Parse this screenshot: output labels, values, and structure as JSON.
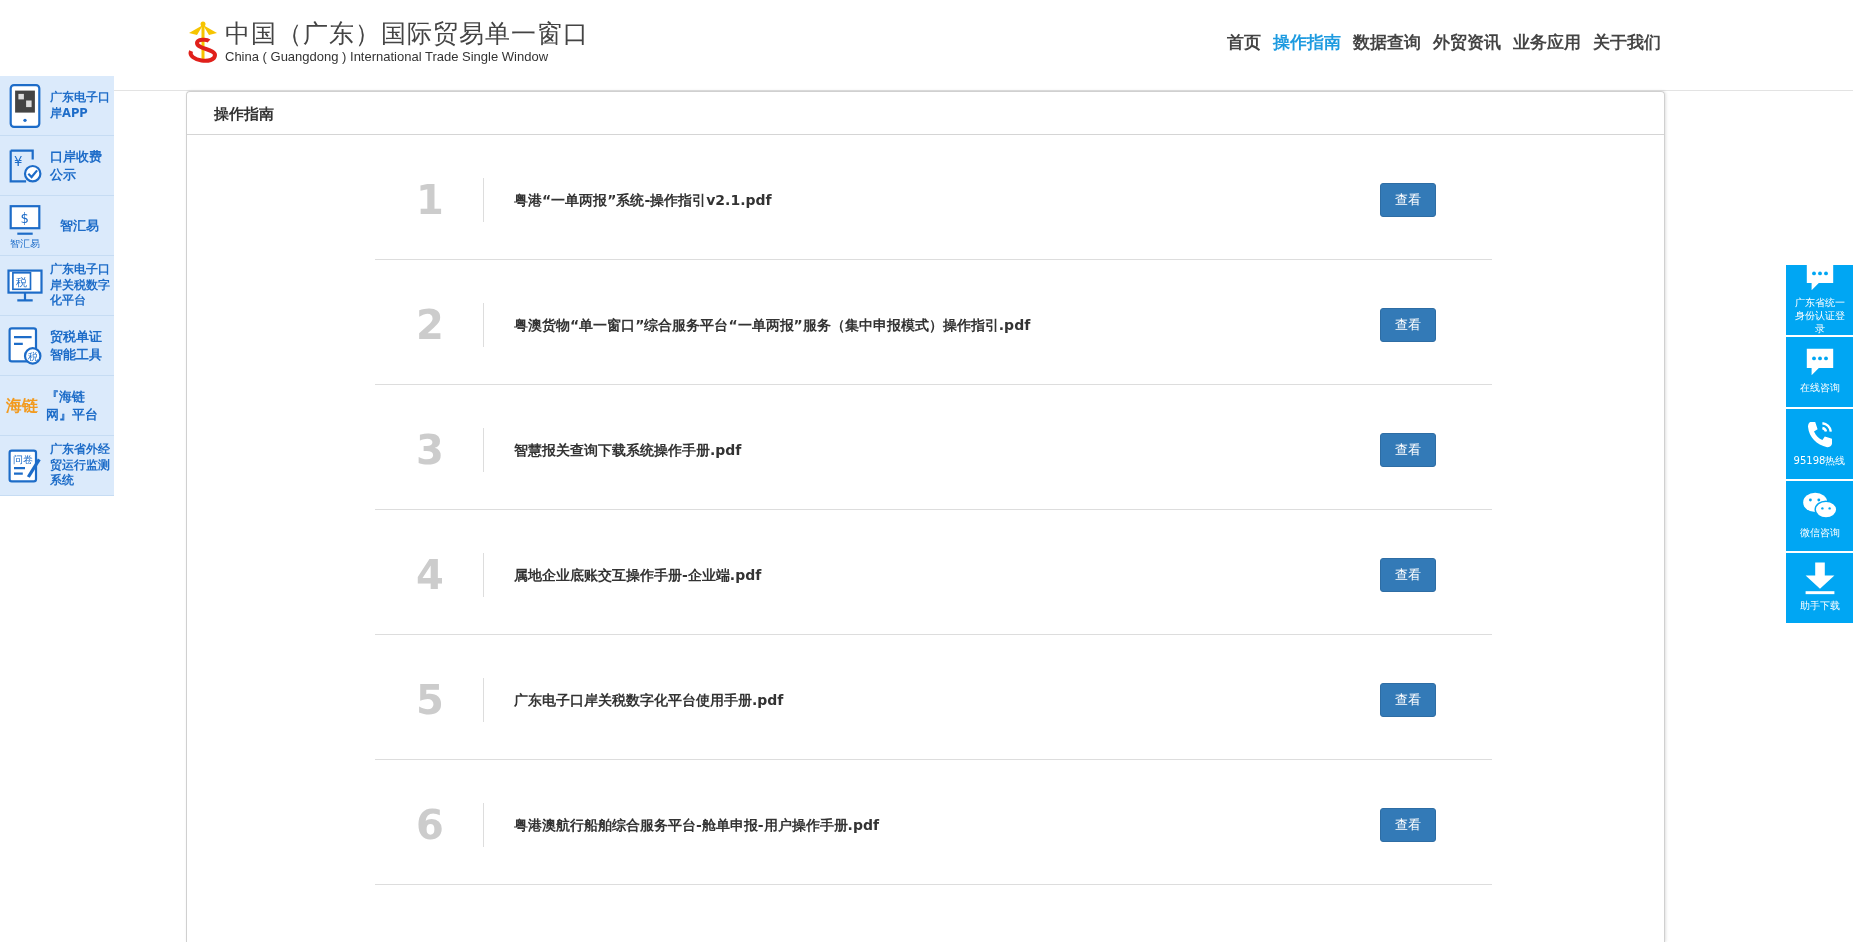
{
  "header": {
    "logo_title": "中国（广东）国际贸易单一窗口",
    "logo_subtitle": "China ( Guangdong ) International Trade Single  Window",
    "nav": [
      {
        "label": "首页",
        "selected": false
      },
      {
        "label": "操作指南",
        "selected": true
      },
      {
        "label": "数据查询",
        "selected": false
      },
      {
        "label": "外贸资讯",
        "selected": false
      },
      {
        "label": "业务应用",
        "selected": false
      },
      {
        "label": "关于我们",
        "selected": false
      }
    ]
  },
  "left_sidebar": [
    {
      "kind": "phone",
      "label": "广东电子口岸APP"
    },
    {
      "kind": "receipt",
      "label": "口岸收费公示",
      "icon_text": "¥"
    },
    {
      "kind": "monitor",
      "label": "智汇易",
      "icon_text": "$",
      "icon_caption": "智汇易"
    },
    {
      "kind": "screen",
      "label": "广东电子口岸关税数字化平台",
      "icon_text": "税"
    },
    {
      "kind": "document",
      "label": "贸税单证智能工具",
      "icon_text": "税"
    },
    {
      "kind": "wordmark",
      "label": "『海链网』平台",
      "icon_text": "海链"
    },
    {
      "kind": "form",
      "label": "广东省外经贸运行监测系统",
      "icon_text": "问卷"
    }
  ],
  "panel": {
    "title": "操作指南",
    "rows": [
      {
        "number": "1",
        "title": "粤港“一单两报”系统-操作指引v2.1.pdf",
        "button": "查看"
      },
      {
        "number": "2",
        "title": "粤澳货物“单一窗口”综合服务平台“一单两报”服务（集中申报模式）操作指引.pdf",
        "button": "查看"
      },
      {
        "number": "3",
        "title": "智慧报关查询下载系统操作手册.pdf",
        "button": "查看"
      },
      {
        "number": "4",
        "title": "属地企业底账交互操作手册-企业端.pdf",
        "button": "查看"
      },
      {
        "number": "5",
        "title": "广东电子口岸关税数字化平台使用手册.pdf",
        "button": "查看"
      },
      {
        "number": "6",
        "title": "粤港澳航行船舶综合服务平台-舱单申报-用户操作手册.pdf",
        "button": "查看"
      }
    ]
  },
  "right_sidebar": [
    {
      "kind": "chat",
      "label": "广东省统一身份认证登录"
    },
    {
      "kind": "chat",
      "label": "在线咨询"
    },
    {
      "kind": "phone",
      "label": "95198热线"
    },
    {
      "kind": "wechat",
      "label": "微信咨询"
    },
    {
      "kind": "download",
      "label": "助手下载"
    }
  ]
}
